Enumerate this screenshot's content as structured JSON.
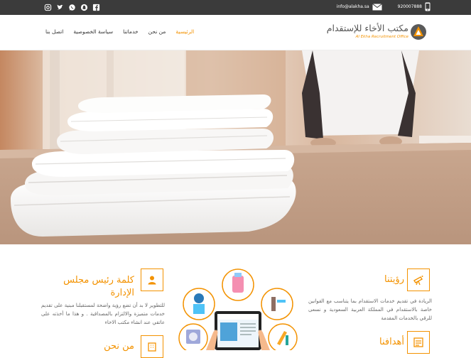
{
  "topbar": {
    "phone": "920007888",
    "email": "info@alakha.sa",
    "social_icons": [
      "facebook-icon",
      "snapchat-icon",
      "whatsapp-icon",
      "twitter-icon",
      "instagram-icon"
    ]
  },
  "brand": {
    "name_ar": "مكتب الأخاء للإستقدام",
    "name_en": "Al Ekha Recruitment Office"
  },
  "nav": {
    "items": [
      {
        "label": "الرئيسية",
        "active": true
      },
      {
        "label": "من نحن",
        "active": false
      },
      {
        "label": "خدماتنا",
        "active": false
      },
      {
        "label": "سياسة الخصوصية",
        "active": false
      },
      {
        "label": "اتصل بنا",
        "active": false
      }
    ]
  },
  "vision": {
    "title": "رؤيتنا",
    "text": "الريادة في تقديم خدمات الاستقدام بما يتناسب مع القوانين خاصة بالاستقدام في المملكة العربية السعودية و نسعى للرقي بالخدمات المقدمة"
  },
  "goals": {
    "title": "أهدافنا"
  },
  "chairman": {
    "title": "كلمة رئيس مجلس الإدارة",
    "text": "للتطوير لا بد أن تضع رؤية واضحة لمستقبلنا مبنية على تقديم خدمات متميزة والالتزام بالمصداقية . و هذا ما أخذته على عاتقي عند انشاء مكتب الاخاء"
  },
  "about": {
    "title": "من نحن"
  },
  "colors": {
    "accent": "#f39200",
    "topbar": "#3b3b3b"
  }
}
